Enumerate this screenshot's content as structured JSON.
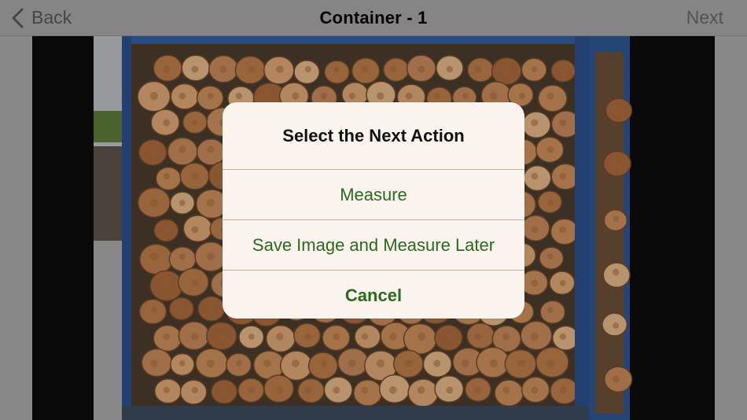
{
  "navbar": {
    "back_label": "Back",
    "title": "Container - 1",
    "next_label": "Next"
  },
  "alert": {
    "title": "Select the Next Action",
    "buttons": [
      {
        "label": "Measure"
      },
      {
        "label": "Save Image and Measure Later"
      },
      {
        "label": "Cancel"
      }
    ]
  },
  "icons": {
    "back": "chevron-left-icon"
  },
  "colors": {
    "accent_green": "#2c6a1e",
    "alert_background": "#fbf3ee",
    "separator": "#d9a990",
    "navbar_background": "#a3a3a3",
    "photo_container_blue": "#2f5fa0"
  }
}
